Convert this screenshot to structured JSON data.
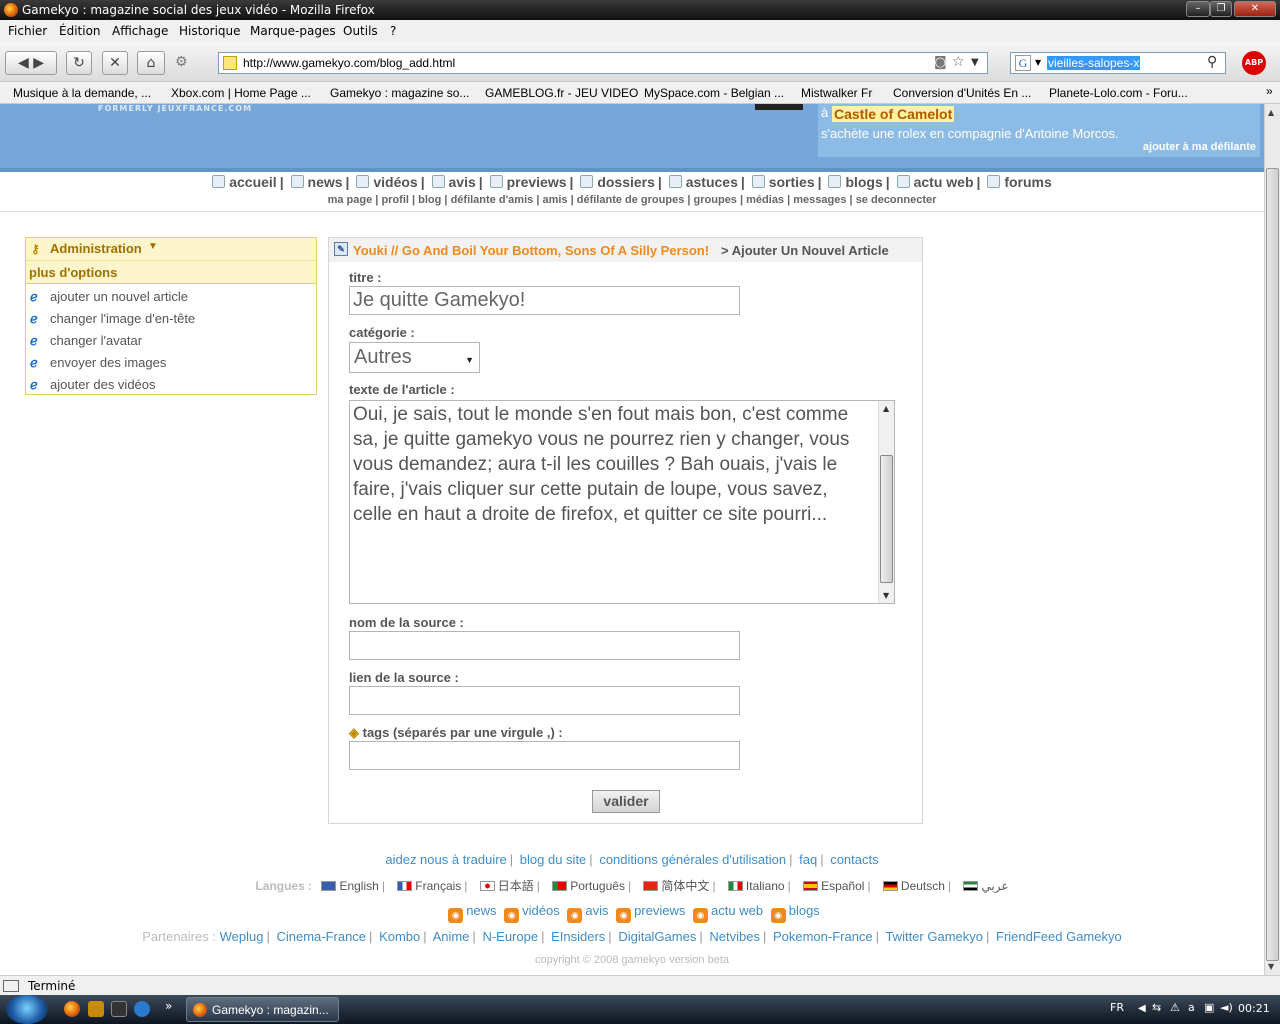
{
  "window": {
    "title": "Gamekyo : magazine social des jeux vidéo - Mozilla Firefox"
  },
  "menu": [
    "Fichier",
    "Édition",
    "Affichage",
    "Historique",
    "Marque-pages",
    "Outils",
    "?"
  ],
  "nav": {
    "url": "http://www.gamekyo.com/blog_add.html",
    "search_value": "vieilles-salopes-x",
    "search_engine_letter": "G",
    "abp_label": "ABP"
  },
  "bookmarks": [
    "Musique à la demande, ...",
    "Xbox.com | Home Page ...",
    "Gamekyo : magazine so...",
    "GAMEBLOG.fr - JEU VIDEO",
    "MySpace.com - Belgian ...",
    "Mistwalker Fr",
    "Conversion d'Unités En ...",
    "Planete-Lolo.com - Foru..."
  ],
  "banner": {
    "formerly": "FORMERLY JEUXFRANCE.COM",
    "ticker_prefix": "à",
    "ticker_game": "Castle of Camelot",
    "ticker_desc": "s'achète une rolex en compagnie d'Antoine Morcos.",
    "ticker_add": "ajouter à ma défilante"
  },
  "mainnav": {
    "items": [
      "accueil",
      "news",
      "vidéos",
      "avis",
      "previews",
      "dossiers",
      "astuces",
      "sorties",
      "blogs",
      "actu web",
      "forums"
    ],
    "sub": [
      "ma page",
      "profil",
      "blog",
      "défilante d'amis",
      "amis",
      "défilante de groupes",
      "groupes",
      "médias",
      "messages",
      "se deconnecter"
    ]
  },
  "sidebar": {
    "title": "Administration",
    "more": "plus d'options",
    "items": [
      {
        "label": "ajouter un nouvel article"
      },
      {
        "label": "changer l'image d'en-tête"
      },
      {
        "label": "changer l'avatar"
      },
      {
        "label": "envoyer des images"
      },
      {
        "label": "ajouter des vidéos"
      }
    ]
  },
  "form": {
    "crumb_blog": "Youki // Go And Boil Your Bottom, Sons Of A Silly Person!",
    "crumb_page": "> Ajouter Un Nouvel Article",
    "titre_label": "titre :",
    "titre_value": "Je quitte Gamekyo!",
    "categorie_label": "catégorie :",
    "categorie_value": "Autres",
    "texte_label": "texte de l'article :",
    "texte_value": "Oui, je sais, tout le monde s'en fout mais bon, c'est comme sa, je quitte gamekyo vous ne pourrez rien y changer, vous vous demandez; aura t-il les couilles ? Bah ouais, j'vais le faire, j'vais cliquer sur cette putain de loupe, vous savez, celle en haut a droite de firefox, et quitter ce site pourri...",
    "source_name_label": "nom de la source :",
    "source_link_label": "lien de la source :",
    "tags_label": "tags (séparés par une virgule ,) :",
    "submit_label": "valider"
  },
  "footer": {
    "links": [
      "aidez nous à traduire",
      "blog du site",
      "conditions générales d'utilisation",
      "faq",
      "contacts"
    ],
    "languages_label": "Langues :",
    "languages": [
      {
        "name": "English",
        "color": "#3a5fae"
      },
      {
        "name": "Français",
        "color": "#2f5fb8"
      },
      {
        "name": "日本語",
        "color": "#e00000"
      },
      {
        "name": "Português",
        "color": "#1f8a3a"
      },
      {
        "name": "简体中文",
        "color": "#de2910"
      },
      {
        "name": "Italiano",
        "color": "#1f8a3a"
      },
      {
        "name": "Español",
        "color": "#c60b1e"
      },
      {
        "name": "Deutsch",
        "color": "#000000"
      },
      {
        "name": "عربي",
        "color": "#1f8a3a"
      }
    ],
    "feeds": [
      "news",
      "vidéos",
      "avis",
      "previews",
      "actu web",
      "blogs"
    ],
    "partners_label": "Partenaires :",
    "partners": [
      "Weplug",
      "Cinema-France",
      "Kombo",
      "Anime",
      "N-Europe",
      "EInsiders",
      "DigitalGames",
      "Netvibes",
      "Pokemon-France",
      "Twitter Gamekyo",
      "FriendFeed Gamekyo"
    ],
    "copyright": "copyright © 2008 gamekyo version beta"
  },
  "status": {
    "text": "Terminé"
  },
  "taskbar": {
    "task_label": "Gamekyo : magazin...",
    "lang": "FR",
    "clock": "00:21"
  }
}
